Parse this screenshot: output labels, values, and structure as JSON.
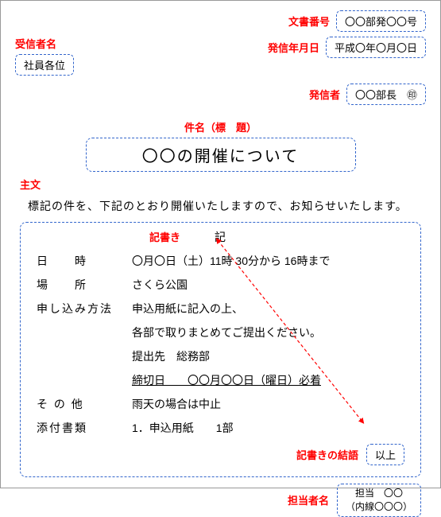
{
  "header": {
    "doc_no_label": "文書番号",
    "doc_no_value": "〇〇部発〇〇号",
    "date_label": "発信年月日",
    "date_value": "平成〇年〇月〇日",
    "recipient_label": "受信者名",
    "recipient_value": "社員各位",
    "sender_label": "発信者",
    "sender_value": "〇〇部長　㊞"
  },
  "title": {
    "label": "件名（標　題）",
    "value": "〇〇の開催について"
  },
  "main": {
    "label": "主文",
    "text": "標記の件を、下記のとおり開催いたしますので、お知らせいたします。"
  },
  "kigaki": {
    "label": "記書き",
    "heading": "記",
    "items": {
      "datetime_label": "日　　時",
      "datetime_value": "〇月〇日（土）11時 30分から 16時まで",
      "place_label": "場　　所",
      "place_value": "さくら公園",
      "apply_label": "申し込み方法",
      "apply_line1": "申込用紙に記入の上、",
      "apply_line2": "各部で取りまとめてご提出ください。",
      "submit_to": "提出先　総務部",
      "deadline": "締切日　　〇〇月〇〇日（曜日）必着",
      "other_label": "そ の 他",
      "other_value": "雨天の場合は中止",
      "attach_label": "添付書類",
      "attach_value": "1．申込用紙　　1部"
    },
    "closing_label": "記書きの結語",
    "closing_value": "以上"
  },
  "contact": {
    "label": "担当者名",
    "line1": "担当　〇〇",
    "line2": "（内線〇〇〇）"
  }
}
